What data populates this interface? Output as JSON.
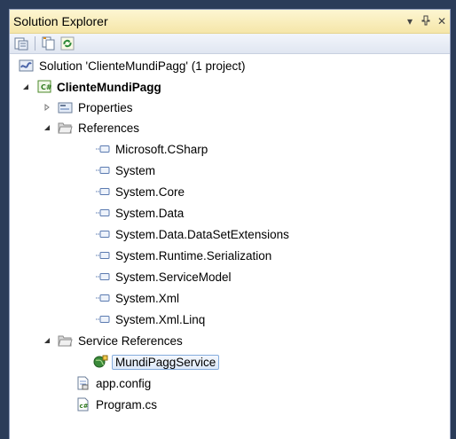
{
  "window": {
    "title": "Solution Explorer",
    "controls": [
      "▼",
      "ᵖ",
      "✕"
    ]
  },
  "toolbar": {
    "buttons": [
      "properties-icon",
      "show-all-files-icon",
      "refresh-icon"
    ]
  },
  "tree": {
    "solution": "Solution 'ClienteMundiPagg' (1 project)",
    "project": "ClienteMundiPagg",
    "properties": "Properties",
    "references": "References",
    "reference_items": [
      "Microsoft.CSharp",
      "System",
      "System.Core",
      "System.Data",
      "System.Data.DataSetExtensions",
      "System.Runtime.Serialization",
      "System.ServiceModel",
      "System.Xml",
      "System.Xml.Linq"
    ],
    "service_references": "Service References",
    "service_items": [
      "MundiPaggService"
    ],
    "app_config": "app.config",
    "program": "Program.cs"
  },
  "colors": {
    "title_bar": "#f5e6a9",
    "window_bg": "#2b3c59",
    "selection_border": "#84acdd"
  }
}
